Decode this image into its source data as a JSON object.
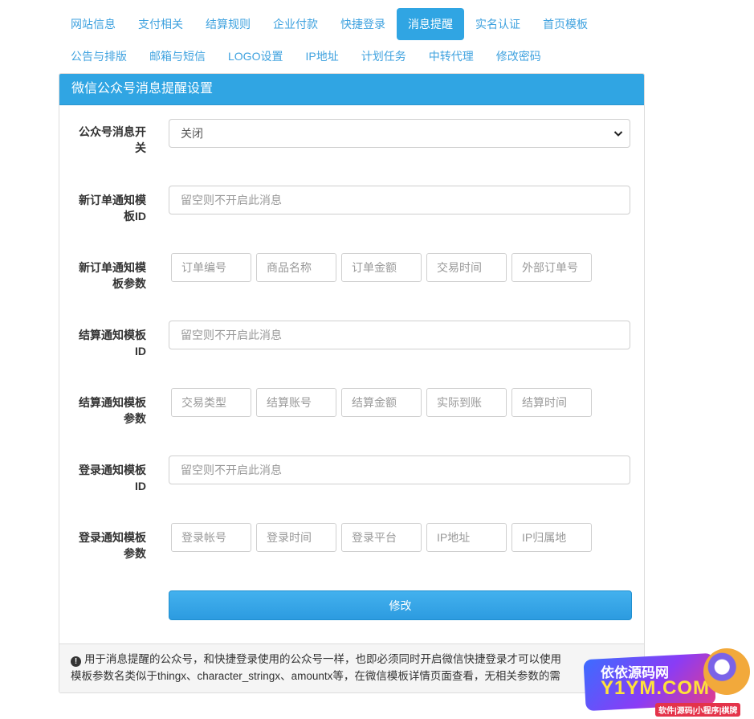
{
  "tabs": {
    "row1": [
      {
        "label": "网站信息",
        "active": false
      },
      {
        "label": "支付相关",
        "active": false
      },
      {
        "label": "结算规则",
        "active": false
      },
      {
        "label": "企业付款",
        "active": false
      },
      {
        "label": "快捷登录",
        "active": false
      },
      {
        "label": "消息提醒",
        "active": true
      },
      {
        "label": "实名认证",
        "active": false
      },
      {
        "label": "首页模板",
        "active": false
      }
    ],
    "row2": [
      {
        "label": "公告与排版",
        "active": false
      },
      {
        "label": "邮箱与短信",
        "active": false
      },
      {
        "label": "LOGO设置",
        "active": false
      },
      {
        "label": "IP地址",
        "active": false
      },
      {
        "label": "计划任务",
        "active": false
      },
      {
        "label": "中转代理",
        "active": false
      },
      {
        "label": "修改密码",
        "active": false
      }
    ]
  },
  "panel": {
    "title": "微信公众号消息提醒设置",
    "switch": {
      "label_line1": "公众号消息开",
      "label_line2": "关",
      "selected": "关闭",
      "icon": "chevron-down-icon"
    },
    "order_tpl_id": {
      "label_line1": "新订单通知模",
      "label_line2": "板ID",
      "placeholder": "留空则不开启此消息"
    },
    "order_tpl_params": {
      "label_line1": "新订单通知模",
      "label_line2": "板参数",
      "placeholders": [
        "订单编号",
        "商品名称",
        "订单金额",
        "交易时间",
        "外部订单号"
      ]
    },
    "settle_tpl_id": {
      "label_line1": "结算通知模板",
      "label_line2": "ID",
      "placeholder": "留空则不开启此消息"
    },
    "settle_tpl_params": {
      "label_line1": "结算通知模板",
      "label_line2": "参数",
      "placeholders": [
        "交易类型",
        "结算账号",
        "结算金额",
        "实际到账",
        "结算时间"
      ]
    },
    "login_tpl_id": {
      "label_line1": "登录通知模板",
      "label_line2": "ID",
      "placeholder": "留空则不开启此消息"
    },
    "login_tpl_params": {
      "label_line1": "登录通知模板",
      "label_line2": "参数",
      "placeholders": [
        "登录帐号",
        "登录时间",
        "登录平台",
        "IP地址",
        "IP归属地"
      ]
    },
    "submit_label": "修改",
    "footer": {
      "icon": "info-icon",
      "line1": "用于消息提醒的公众号，和快捷登录使用的公众号一样，也即必须同时开启微信快捷登录才可以使用",
      "line2": "模板参数名类似于thingx、character_stringx、amountx等，在微信模板详情页面查看，无相关参数的需"
    }
  },
  "watermark": {
    "line1": "依依源码网",
    "line2": "Y1YM.COM",
    "line3": "软件|源码|小程序|棋牌"
  },
  "colors": {
    "accent": "#30a5e3",
    "tab_text": "#3fa2df"
  }
}
